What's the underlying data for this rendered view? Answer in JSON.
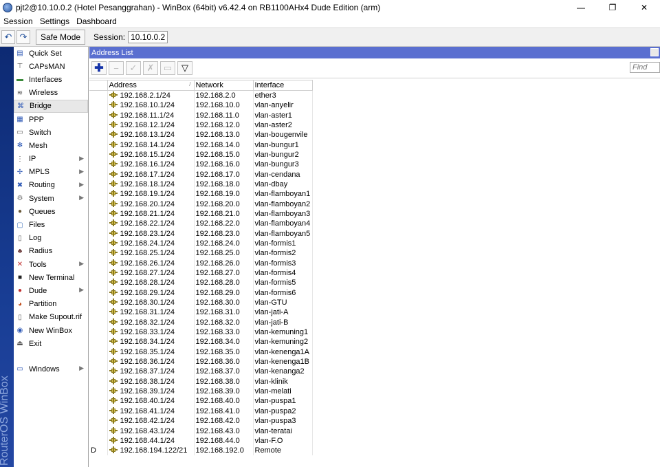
{
  "window": {
    "title": "pjt2@10.10.0.2 (Hotel Pesanggrahan) - WinBox (64bit) v6.42.4 on RB1100AHx4 Dude Edition (arm)",
    "minimize": "—",
    "restore": "❐",
    "close": "✕"
  },
  "menubar": [
    "Session",
    "Settings",
    "Dashboard"
  ],
  "toolbar": {
    "undo": "↶",
    "redo": "↷",
    "safe_mode": "Safe Mode",
    "session_label": "Session:",
    "session_value": "10.10.0.2"
  },
  "branding": "RouterOS WinBox",
  "sidebar": [
    {
      "label": "Quick Set",
      "icon": "quick-set-icon",
      "submenu": false
    },
    {
      "label": "CAPsMAN",
      "icon": "capsman-icon",
      "submenu": false
    },
    {
      "label": "Interfaces",
      "icon": "interfaces-icon",
      "submenu": false
    },
    {
      "label": "Wireless",
      "icon": "wireless-icon",
      "submenu": false
    },
    {
      "label": "Bridge",
      "icon": "bridge-icon",
      "submenu": false,
      "active": true
    },
    {
      "label": "PPP",
      "icon": "ppp-icon",
      "submenu": false
    },
    {
      "label": "Switch",
      "icon": "switch-icon",
      "submenu": false
    },
    {
      "label": "Mesh",
      "icon": "mesh-icon",
      "submenu": false
    },
    {
      "label": "IP",
      "icon": "ip-icon",
      "submenu": true
    },
    {
      "label": "MPLS",
      "icon": "mpls-icon",
      "submenu": true
    },
    {
      "label": "Routing",
      "icon": "routing-icon",
      "submenu": true
    },
    {
      "label": "System",
      "icon": "system-icon",
      "submenu": true
    },
    {
      "label": "Queues",
      "icon": "queues-icon",
      "submenu": false
    },
    {
      "label": "Files",
      "icon": "files-icon",
      "submenu": false
    },
    {
      "label": "Log",
      "icon": "log-icon",
      "submenu": false
    },
    {
      "label": "Radius",
      "icon": "radius-icon",
      "submenu": false
    },
    {
      "label": "Tools",
      "icon": "tools-icon",
      "submenu": true
    },
    {
      "label": "New Terminal",
      "icon": "terminal-icon",
      "submenu": false
    },
    {
      "label": "Dude",
      "icon": "dude-icon",
      "submenu": true
    },
    {
      "label": "Partition",
      "icon": "partition-icon",
      "submenu": false
    },
    {
      "label": "Make Supout.rif",
      "icon": "supout-icon",
      "submenu": false
    },
    {
      "label": "New WinBox",
      "icon": "winbox-icon",
      "submenu": false
    },
    {
      "label": "Exit",
      "icon": "exit-icon",
      "submenu": false
    }
  ],
  "sidebar_bottom": {
    "label": "Windows",
    "icon": "windows-icon",
    "submenu": true
  },
  "address_list": {
    "title": "Address List",
    "find_placeholder": "Find",
    "columns": [
      "Address",
      "Network",
      "Interface"
    ],
    "sort_indicator": "/",
    "rows": [
      {
        "flag": "",
        "address": "192.168.2.1/24",
        "network": "192.168.2.0",
        "interface": "ether3"
      },
      {
        "flag": "",
        "address": "192.168.10.1/24",
        "network": "192.168.10.0",
        "interface": "vlan-anyelir"
      },
      {
        "flag": "",
        "address": "192.168.11.1/24",
        "network": "192.168.11.0",
        "interface": "vlan-aster1"
      },
      {
        "flag": "",
        "address": "192.168.12.1/24",
        "network": "192.168.12.0",
        "interface": "vlan-aster2"
      },
      {
        "flag": "",
        "address": "192.168.13.1/24",
        "network": "192.168.13.0",
        "interface": "vlan-bougenvile"
      },
      {
        "flag": "",
        "address": "192.168.14.1/24",
        "network": "192.168.14.0",
        "interface": "vlan-bungur1"
      },
      {
        "flag": "",
        "address": "192.168.15.1/24",
        "network": "192.168.15.0",
        "interface": "vlan-bungur2"
      },
      {
        "flag": "",
        "address": "192.168.16.1/24",
        "network": "192.168.16.0",
        "interface": "vlan-bungur3"
      },
      {
        "flag": "",
        "address": "192.168.17.1/24",
        "network": "192.168.17.0",
        "interface": "vlan-cendana"
      },
      {
        "flag": "",
        "address": "192.168.18.1/24",
        "network": "192.168.18.0",
        "interface": "vlan-dbay"
      },
      {
        "flag": "",
        "address": "192.168.19.1/24",
        "network": "192.168.19.0",
        "interface": "vlan-flamboyan1"
      },
      {
        "flag": "",
        "address": "192.168.20.1/24",
        "network": "192.168.20.0",
        "interface": "vlan-flamboyan2"
      },
      {
        "flag": "",
        "address": "192.168.21.1/24",
        "network": "192.168.21.0",
        "interface": "vlan-flamboyan3"
      },
      {
        "flag": "",
        "address": "192.168.22.1/24",
        "network": "192.168.22.0",
        "interface": "vlan-flamboyan4"
      },
      {
        "flag": "",
        "address": "192.168.23.1/24",
        "network": "192.168.23.0",
        "interface": "vlan-flamboyan5"
      },
      {
        "flag": "",
        "address": "192.168.24.1/24",
        "network": "192.168.24.0",
        "interface": "vlan-formis1"
      },
      {
        "flag": "",
        "address": "192.168.25.1/24",
        "network": "192.168.25.0",
        "interface": "vlan-formis2"
      },
      {
        "flag": "",
        "address": "192.168.26.1/24",
        "network": "192.168.26.0",
        "interface": "vlan-formis3"
      },
      {
        "flag": "",
        "address": "192.168.27.1/24",
        "network": "192.168.27.0",
        "interface": "vlan-formis4"
      },
      {
        "flag": "",
        "address": "192.168.28.1/24",
        "network": "192.168.28.0",
        "interface": "vlan-formis5"
      },
      {
        "flag": "",
        "address": "192.168.29.1/24",
        "network": "192.168.29.0",
        "interface": "vlan-formis6"
      },
      {
        "flag": "",
        "address": "192.168.30.1/24",
        "network": "192.168.30.0",
        "interface": "vlan-GTU"
      },
      {
        "flag": "",
        "address": "192.168.31.1/24",
        "network": "192.168.31.0",
        "interface": "vlan-jati-A"
      },
      {
        "flag": "",
        "address": "192.168.32.1/24",
        "network": "192.168.32.0",
        "interface": "vlan-jati-B"
      },
      {
        "flag": "",
        "address": "192.168.33.1/24",
        "network": "192.168.33.0",
        "interface": "vlan-kemuning1"
      },
      {
        "flag": "",
        "address": "192.168.34.1/24",
        "network": "192.168.34.0",
        "interface": "vlan-kemuning2"
      },
      {
        "flag": "",
        "address": "192.168.35.1/24",
        "network": "192.168.35.0",
        "interface": "vlan-kenenga1A"
      },
      {
        "flag": "",
        "address": "192.168.36.1/24",
        "network": "192.168.36.0",
        "interface": "vlan-kenenga1B"
      },
      {
        "flag": "",
        "address": "192.168.37.1/24",
        "network": "192.168.37.0",
        "interface": "vlan-kenanga2"
      },
      {
        "flag": "",
        "address": "192.168.38.1/24",
        "network": "192.168.38.0",
        "interface": "vlan-klinik"
      },
      {
        "flag": "",
        "address": "192.168.39.1/24",
        "network": "192.168.39.0",
        "interface": "vlan-melati"
      },
      {
        "flag": "",
        "address": "192.168.40.1/24",
        "network": "192.168.40.0",
        "interface": "vlan-puspa1"
      },
      {
        "flag": "",
        "address": "192.168.41.1/24",
        "network": "192.168.41.0",
        "interface": "vlan-puspa2"
      },
      {
        "flag": "",
        "address": "192.168.42.1/24",
        "network": "192.168.42.0",
        "interface": "vlan-puspa3"
      },
      {
        "flag": "",
        "address": "192.168.43.1/24",
        "network": "192.168.43.0",
        "interface": "vlan-teratai"
      },
      {
        "flag": "",
        "address": "192.168.44.1/24",
        "network": "192.168.44.0",
        "interface": "vlan-F.O"
      },
      {
        "flag": "D",
        "address": "192.168.194.122/21",
        "network": "192.168.192.0",
        "interface": "Remote"
      }
    ]
  },
  "colors": {
    "panel_title_bg": "#5a6fd0",
    "brand_bar": "#183d94",
    "address_icon": "#d8c24a"
  }
}
